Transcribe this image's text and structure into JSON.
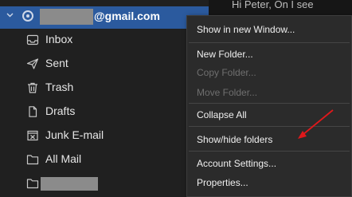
{
  "preview": {
    "text": "Hi Peter, On I see"
  },
  "account": {
    "email_domain": "@gmail.com",
    "expand_icon": "chevron-down-icon",
    "icon": "account-ring-icon"
  },
  "folders": [
    {
      "label": "Inbox",
      "icon": "inbox-icon"
    },
    {
      "label": "Sent",
      "icon": "send-icon"
    },
    {
      "label": "Trash",
      "icon": "trash-icon"
    },
    {
      "label": "Drafts",
      "icon": "draft-icon"
    },
    {
      "label": "Junk E-mail",
      "icon": "junk-icon"
    },
    {
      "label": "All Mail",
      "icon": "folder-icon"
    },
    {
      "label": "",
      "icon": "folder-icon"
    }
  ],
  "context_menu": {
    "items": [
      {
        "label": "Show in new Window...",
        "enabled": true
      },
      {
        "label": "New Folder...",
        "enabled": true
      },
      {
        "label": "Copy Folder...",
        "enabled": false
      },
      {
        "label": "Move Folder...",
        "enabled": false
      },
      {
        "label": "Collapse All",
        "enabled": true
      },
      {
        "label": "Show/hide folders",
        "enabled": true
      },
      {
        "label": "Account Settings...",
        "enabled": true
      },
      {
        "label": "Properties...",
        "enabled": true
      }
    ]
  },
  "colors": {
    "selection": "#2b5a9e",
    "arrow": "#e0181b"
  }
}
